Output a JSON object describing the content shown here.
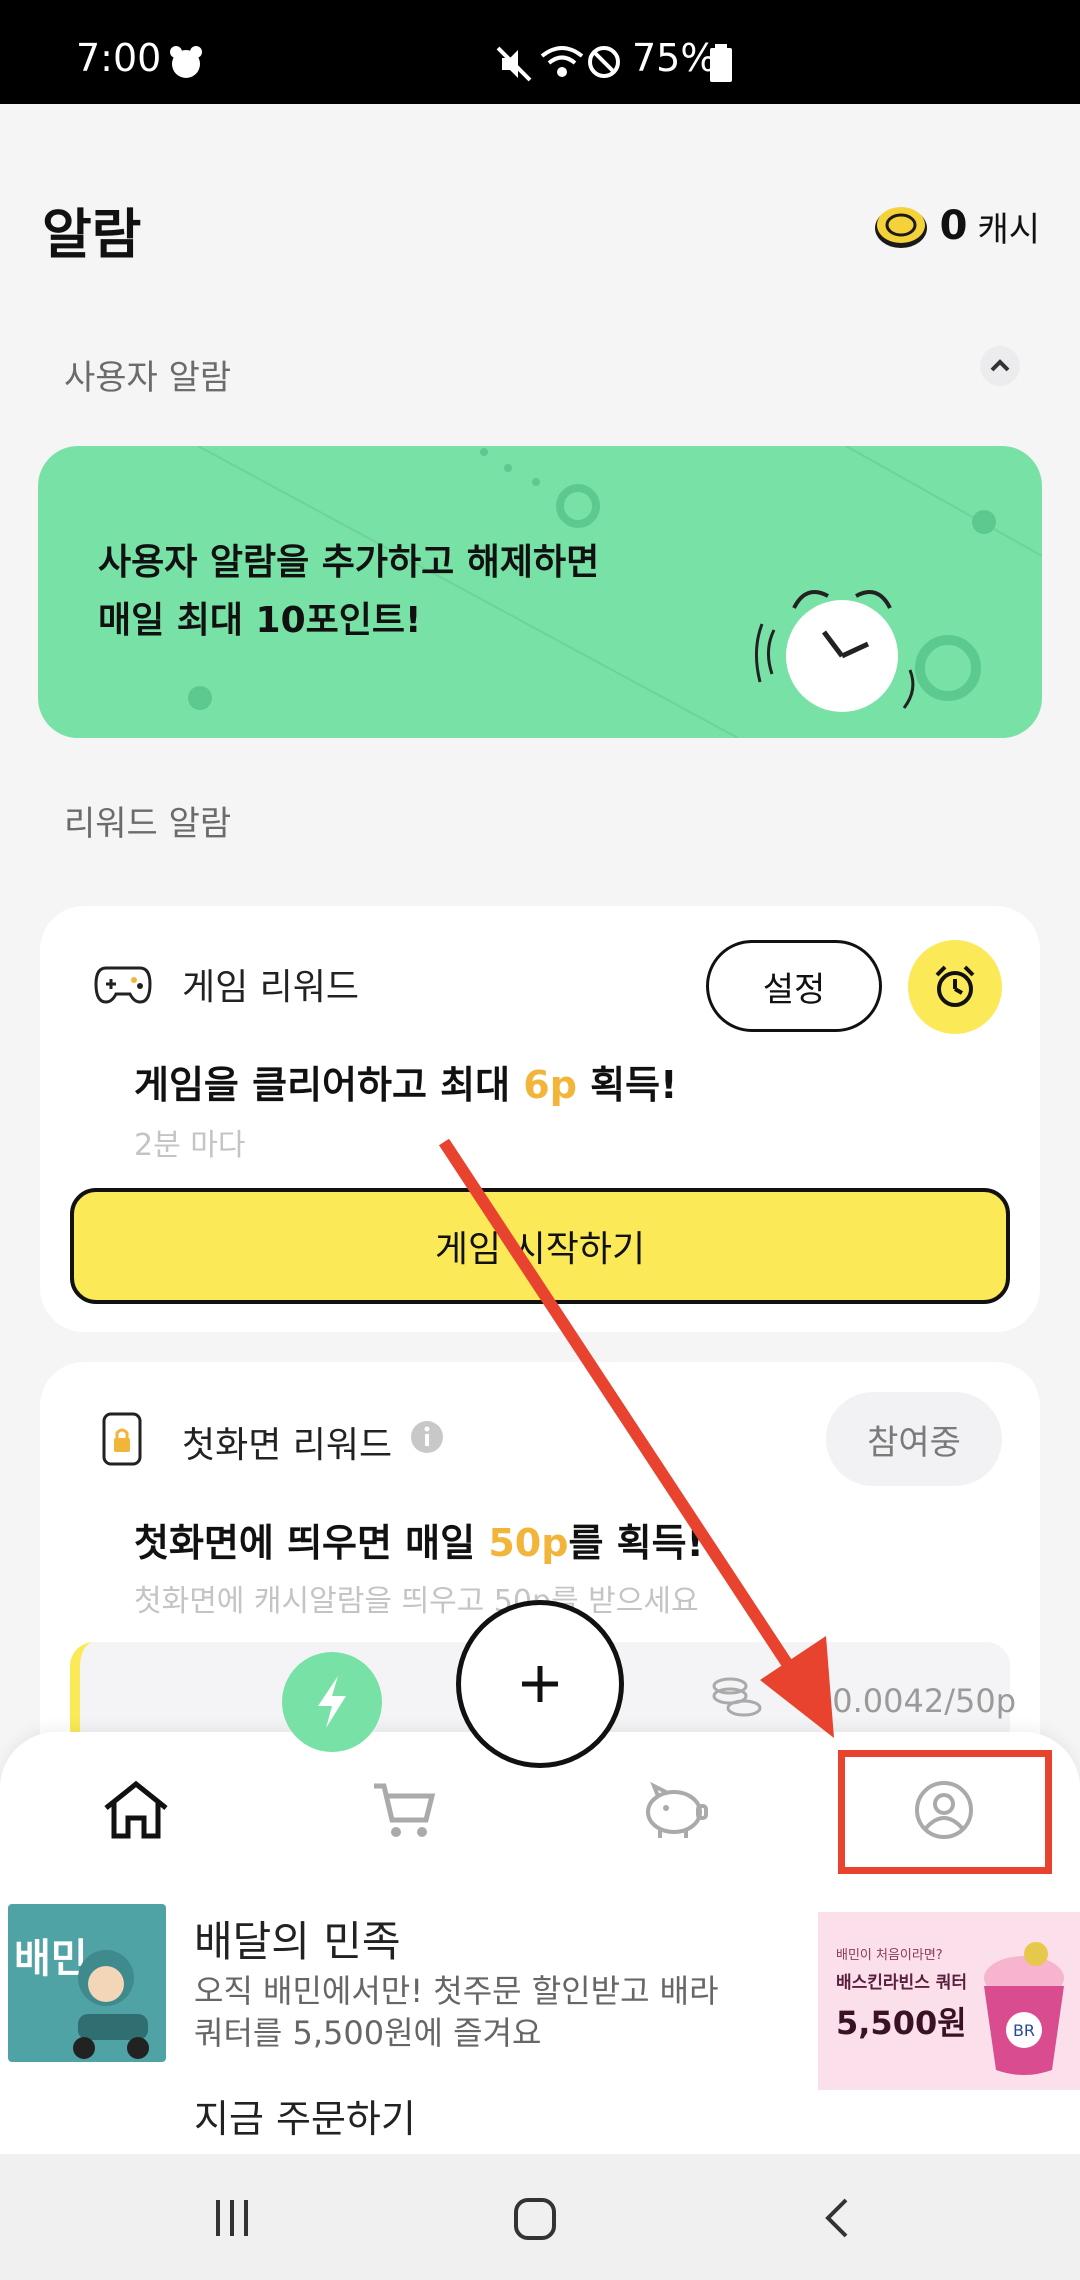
{
  "status_bar": {
    "time": "7:00",
    "battery": "75%"
  },
  "header": {
    "title": "알람",
    "cash_amount": "0",
    "cash_unit": "캐시"
  },
  "user_alarm": {
    "section_label": "사용자 알람",
    "banner_text": "사용자 알람을 추가하고 해제하면\n매일 최대 10포인트!"
  },
  "reward_alarm": {
    "section_label": "리워드 알람",
    "game": {
      "title": "게임 리워드",
      "setting_label": "설정",
      "headline_prefix": "게임을 클리어하고 최대 ",
      "headline_highlight": "6p",
      "headline_suffix": " 획득!",
      "interval": "2분 마다",
      "start_label": "게임 시작하기"
    },
    "lockscreen": {
      "title": "첫화면 리워드",
      "status_label": "참여중",
      "headline_prefix": "첫화면에 띄우면 매일 ",
      "headline_highlight": "50p",
      "headline_suffix": "를 획득!",
      "description": "첫화면에 캐시알람을 띄우고 50p를 받으세요",
      "progress": "0.0042/50p"
    }
  },
  "ad": {
    "title": "배달의 민족",
    "description": "오직 배민에서만! 첫주문 할인받고 배라 쿼터를 5,500원에 즐겨요",
    "cta": "지금 주문하기",
    "thumb_text": "배민",
    "banner_small": "배민이 처음이라면?",
    "banner_line": "배스킨라빈스 쿼터",
    "banner_price": "5,500원"
  },
  "colors": {
    "accent_green": "#78e1a6",
    "accent_yellow": "#fbe958",
    "highlight": "#f2b53a",
    "annotation_red": "#e8432e"
  }
}
